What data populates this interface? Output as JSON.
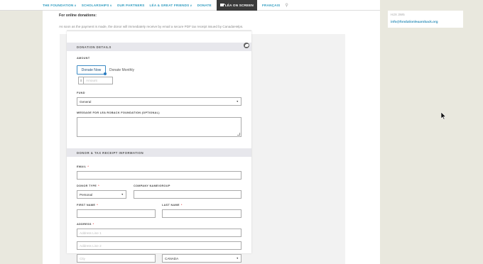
{
  "nav": {
    "items": [
      {
        "label": "THE FOUNDATION",
        "caret": true
      },
      {
        "label": "SCHOLARSHIPS",
        "caret": true
      },
      {
        "label": "OUR PARTNERS",
        "caret": false
      },
      {
        "label": "LÉA & GREAT FRIENDS",
        "caret": true
      },
      {
        "label": "DONATE",
        "caret": false
      }
    ],
    "active": "LÉA ON SCREEN",
    "lang": "FRANÇAIS",
    "caret_glyph": "∨",
    "search_glyph": "⚲"
  },
  "intro": {
    "heading": "For online donations:",
    "text": "As soon as the payment is made, the donor will immediately receive by email a secure PDF tax receipt issued by CanadaHelps."
  },
  "form": {
    "donation_details": "DONATION DETAILS",
    "amount_label": "AMOUNT",
    "donate_now": "Donate Now",
    "donate_monthly": "Donate Monthly",
    "currency": "$",
    "amount_placeholder": "Amount",
    "fund_label": "FUND",
    "fund_value": "General",
    "message_label": "MESSAGE FOR LEA ROBACK FOUNDATION (OPTIONAL)",
    "receipt_section": "DONOR & TAX RECEIPT INFORMATION",
    "email_label": "EMAIL",
    "required_mark": "*",
    "donor_type_label": "DONOR TYPE",
    "donor_type_value": "Personal",
    "company_label": "COMPANY NAME/GROUP",
    "first_name_label": "FIRST NAME",
    "last_name_label": "LAST NAME",
    "address_label": "ADDRESS",
    "address1_placeholder": "Address Line 1",
    "address2_placeholder": "Address Line 2",
    "city_placeholder": "City",
    "country_value": "CANADA",
    "select_arrow": "▼"
  },
  "sidebar": {
    "postal": "H2X 3W5",
    "email": "info@fondationleaaroback.org"
  }
}
